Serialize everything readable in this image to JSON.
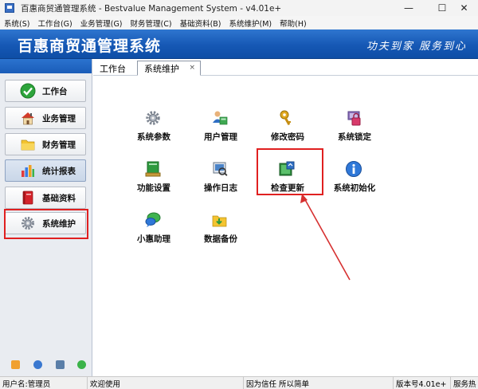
{
  "window": {
    "title": "百惠商贸通管理系统 - Bestvalue Management System - v4.01e+",
    "minimize_glyph": "—",
    "maximize_glyph": "☐",
    "close_glyph": "✕"
  },
  "menu": {
    "items": [
      {
        "label": "系统(S)"
      },
      {
        "label": "工作台(G)"
      },
      {
        "label": "业务管理(G)"
      },
      {
        "label": "财务管理(C)"
      },
      {
        "label": "基础资料(B)"
      },
      {
        "label": "系统维护(M)"
      },
      {
        "label": "帮助(H)"
      }
    ]
  },
  "banner": {
    "app_name": "百惠商贸通管理系统",
    "slogan": "功夫到家  服务到心"
  },
  "nav": {
    "items": [
      {
        "label": "工作台",
        "icon": "checkmark-icon"
      },
      {
        "label": "业务管理",
        "icon": "house-icon"
      },
      {
        "label": "财务管理",
        "icon": "folder-icon"
      },
      {
        "label": "统计报表",
        "icon": "chart-icon"
      },
      {
        "label": "基础资料",
        "icon": "book-icon"
      },
      {
        "label": "系统维护",
        "icon": "gear-icon"
      }
    ],
    "active_index": 3
  },
  "tabs": {
    "workbench": "工作台",
    "sysmaint": "系统维护",
    "close_glyph": "×"
  },
  "tiles": {
    "sys_params": "系统参数",
    "user_mgmt": "用户管理",
    "change_pwd": "修改密码",
    "sys_lock": "系统锁定",
    "func_settings": "功能设置",
    "op_log": "操作日志",
    "check_update": "检查更新",
    "sys_init": "系统初始化",
    "assistant": "小惠助理",
    "data_backup": "数据备份"
  },
  "status": {
    "user": "用户名:管理员",
    "welcome": "欢迎使用",
    "slogan": "因为信任 所以简单",
    "version": "版本号4.01e+",
    "service": "服务热"
  },
  "colors": {
    "banner": "#1658b5",
    "highlight": "#e02020",
    "arrow": "#d63030"
  }
}
